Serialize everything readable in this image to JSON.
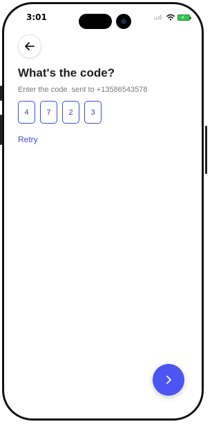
{
  "status_bar": {
    "time": "3:01",
    "icons": [
      "signal-icon",
      "wifi-icon",
      "battery-charging-icon"
    ]
  },
  "header": {
    "back_icon": "arrow-left-icon"
  },
  "main": {
    "title": "What's the code?",
    "subtitle": "Enter the code  sent to +13586543578",
    "code_digits": [
      "4",
      "7",
      "2",
      "3"
    ],
    "retry_label": "Retry"
  },
  "footer": {
    "next_icon": "chevron-right-icon"
  },
  "colors": {
    "accent": "#4a55f2",
    "code_border": "#3b4bd6",
    "title": "#1d1d1d",
    "subtitle": "#7a7a7a"
  }
}
